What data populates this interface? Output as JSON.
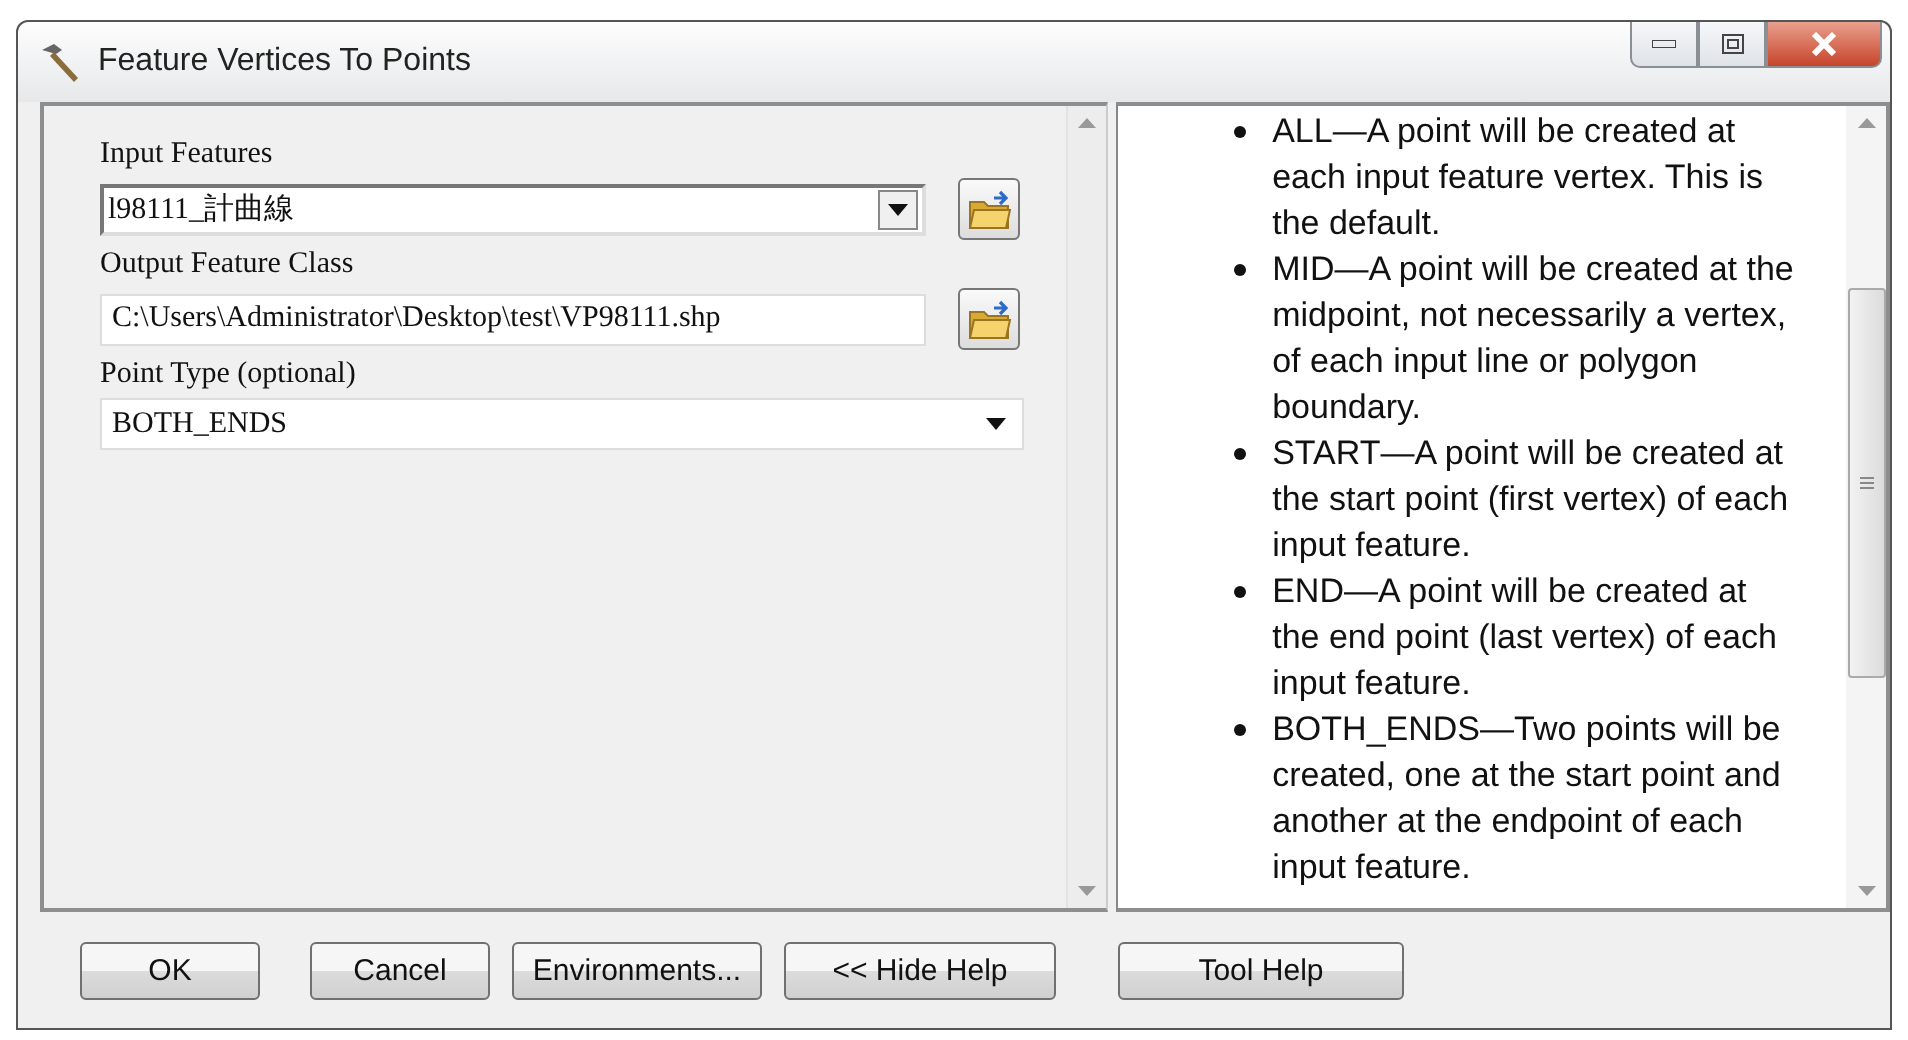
{
  "window": {
    "title": "Feature Vertices To Points"
  },
  "parameters": [
    {
      "kind": "combo",
      "label": "Input Features",
      "value": "l98111_計曲線",
      "browse": true
    },
    {
      "kind": "text",
      "label": "Output Feature Class",
      "value": "C:\\Users\\Administrator\\Desktop\\test\\VP98111.shp",
      "browse": true
    },
    {
      "kind": "select",
      "label": "Point Type (optional)",
      "value": "BOTH_ENDS",
      "browse": false
    }
  ],
  "help_items": [
    "ALL—A point will be created at each input feature vertex. This is the default.",
    "MID—A point will be created at the midpoint, not necessarily a vertex, of each input line or polygon boundary.",
    "START—A point will be created at the start point (first vertex) of each input feature.",
    "END—A point will be created at the end point (last vertex) of each input feature.",
    "BOTH_ENDS—Two points will be created, one at the start point and another at the endpoint of each input feature."
  ],
  "buttons": [
    "OK",
    "Cancel",
    "Environments...",
    "<< Hide Help"
  ],
  "help_button": "Tool Help"
}
